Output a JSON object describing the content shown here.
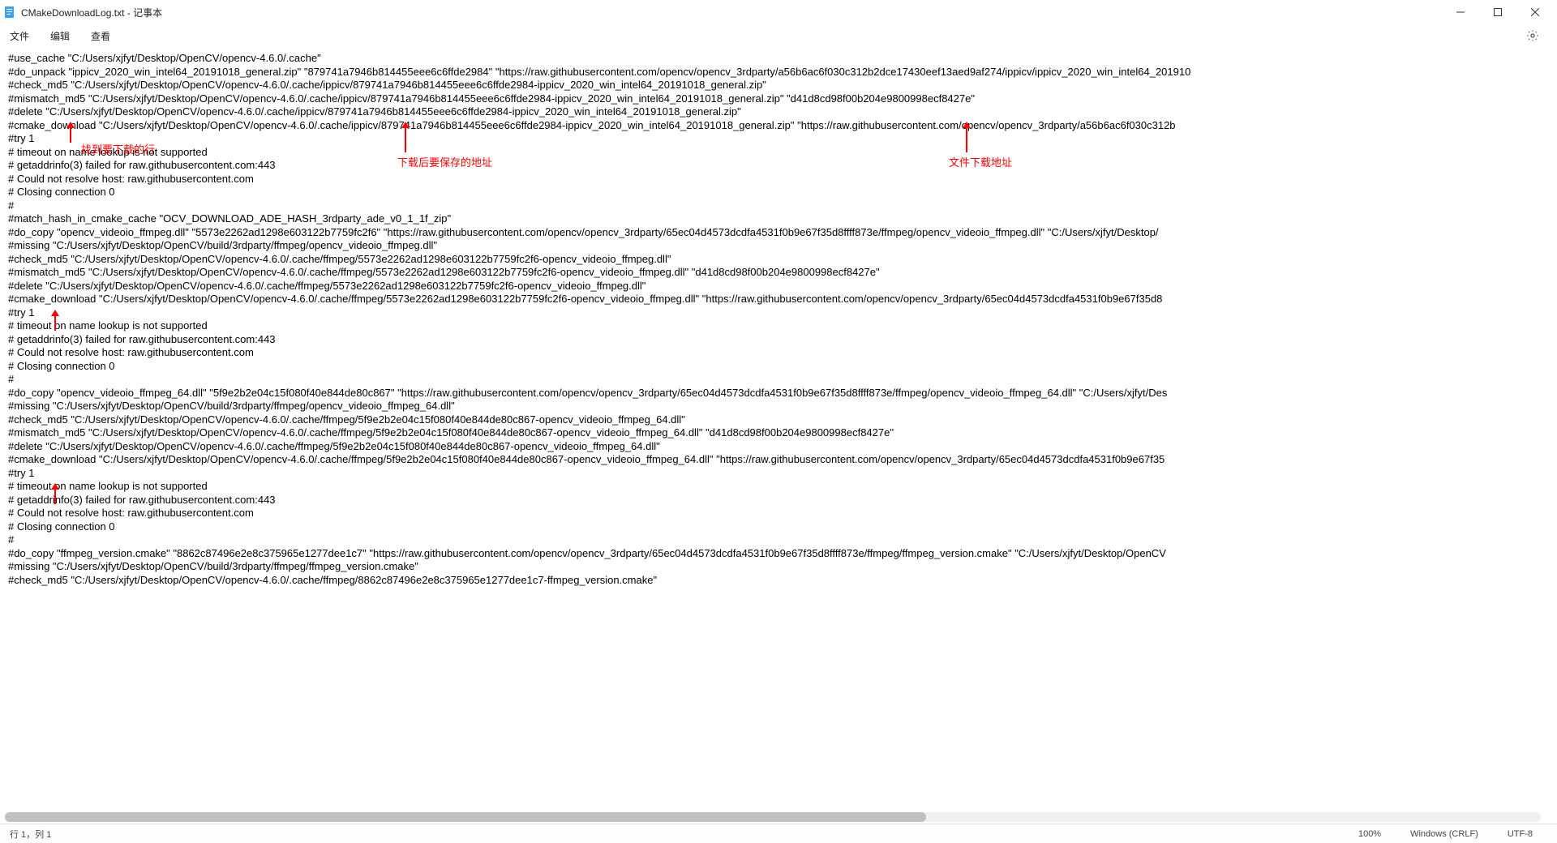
{
  "window": {
    "title": "CMakeDownloadLog.txt - 记事本"
  },
  "menu": {
    "file": "文件",
    "edit": "编辑",
    "view": "查看"
  },
  "annotations": {
    "a1": "找到要下载的行",
    "a2": "下载后要保存的地址",
    "a3": "文件下载地址"
  },
  "lines": {
    "l0": "#use_cache \"C:/Users/xjfyt/Desktop/OpenCV/opencv-4.6.0/.cache\"",
    "l1": "#do_unpack \"ippicv_2020_win_intel64_20191018_general.zip\" \"879741a7946b814455eee6c6ffde2984\" \"https://raw.githubusercontent.com/opencv/opencv_3rdparty/a56b6ac6f030c312b2dce17430eef13aed9af274/ippicv/ippicv_2020_win_intel64_201910",
    "l2": "#check_md5 \"C:/Users/xjfyt/Desktop/OpenCV/opencv-4.6.0/.cache/ippicv/879741a7946b814455eee6c6ffde2984-ippicv_2020_win_intel64_20191018_general.zip\"",
    "l3": "#mismatch_md5 \"C:/Users/xjfyt/Desktop/OpenCV/opencv-4.6.0/.cache/ippicv/879741a7946b814455eee6c6ffde2984-ippicv_2020_win_intel64_20191018_general.zip\" \"d41d8cd98f00b204e9800998ecf8427e\"",
    "l4": "#delete \"C:/Users/xjfyt/Desktop/OpenCV/opencv-4.6.0/.cache/ippicv/879741a7946b814455eee6c6ffde2984-ippicv_2020_win_intel64_20191018_general.zip\"",
    "l5": "#cmake_download \"C:/Users/xjfyt/Desktop/OpenCV/opencv-4.6.0/.cache/ippicv/879741a7946b814455eee6c6ffde2984-ippicv_2020_win_intel64_20191018_general.zip\" \"https://raw.githubusercontent.com/opencv/opencv_3rdparty/a56b6ac6f030c312b",
    "l6": "#try 1",
    "l7": "# timeout on name lookup is not supported",
    "l8": "# getaddrinfo(3) failed for raw.githubusercontent.com:443",
    "l9": "# Could not resolve host: raw.githubusercontent.com",
    "l10": "# Closing connection 0",
    "l11": "#",
    "l12": "",
    "l13": "#match_hash_in_cmake_cache \"OCV_DOWNLOAD_ADE_HASH_3rdparty_ade_v0_1_1f_zip\"",
    "l14": "#do_copy \"opencv_videoio_ffmpeg.dll\" \"5573e2262ad1298e603122b7759fc2f6\" \"https://raw.githubusercontent.com/opencv/opencv_3rdparty/65ec04d4573dcdfa4531f0b9e67f35d8ffff873e/ffmpeg/opencv_videoio_ffmpeg.dll\" \"C:/Users/xjfyt/Desktop/",
    "l15": "#missing \"C:/Users/xjfyt/Desktop/OpenCV/build/3rdparty/ffmpeg/opencv_videoio_ffmpeg.dll\"",
    "l16": "#check_md5 \"C:/Users/xjfyt/Desktop/OpenCV/opencv-4.6.0/.cache/ffmpeg/5573e2262ad1298e603122b7759fc2f6-opencv_videoio_ffmpeg.dll\"",
    "l17": "#mismatch_md5 \"C:/Users/xjfyt/Desktop/OpenCV/opencv-4.6.0/.cache/ffmpeg/5573e2262ad1298e603122b7759fc2f6-opencv_videoio_ffmpeg.dll\" \"d41d8cd98f00b204e9800998ecf8427e\"",
    "l18": "#delete \"C:/Users/xjfyt/Desktop/OpenCV/opencv-4.6.0/.cache/ffmpeg/5573e2262ad1298e603122b7759fc2f6-opencv_videoio_ffmpeg.dll\"",
    "l19": "#cmake_download \"C:/Users/xjfyt/Desktop/OpenCV/opencv-4.6.0/.cache/ffmpeg/5573e2262ad1298e603122b7759fc2f6-opencv_videoio_ffmpeg.dll\" \"https://raw.githubusercontent.com/opencv/opencv_3rdparty/65ec04d4573dcdfa4531f0b9e67f35d8",
    "l20": "#try 1",
    "l21": "# timeout on name lookup is not supported",
    "l22": "# getaddrinfo(3) failed for raw.githubusercontent.com:443",
    "l23": "# Could not resolve host: raw.githubusercontent.com",
    "l24": "# Closing connection 0",
    "l25": "#",
    "l26": "",
    "l27": "#do_copy \"opencv_videoio_ffmpeg_64.dll\" \"5f9e2b2e04c15f080f40e844de80c867\" \"https://raw.githubusercontent.com/opencv/opencv_3rdparty/65ec04d4573dcdfa4531f0b9e67f35d8ffff873e/ffmpeg/opencv_videoio_ffmpeg_64.dll\" \"C:/Users/xjfyt/Des",
    "l28": "#missing \"C:/Users/xjfyt/Desktop/OpenCV/build/3rdparty/ffmpeg/opencv_videoio_ffmpeg_64.dll\"",
    "l29": "#check_md5 \"C:/Users/xjfyt/Desktop/OpenCV/opencv-4.6.0/.cache/ffmpeg/5f9e2b2e04c15f080f40e844de80c867-opencv_videoio_ffmpeg_64.dll\"",
    "l30": "#mismatch_md5 \"C:/Users/xjfyt/Desktop/OpenCV/opencv-4.6.0/.cache/ffmpeg/5f9e2b2e04c15f080f40e844de80c867-opencv_videoio_ffmpeg_64.dll\" \"d41d8cd98f00b204e9800998ecf8427e\"",
    "l31": "#delete \"C:/Users/xjfyt/Desktop/OpenCV/opencv-4.6.0/.cache/ffmpeg/5f9e2b2e04c15f080f40e844de80c867-opencv_videoio_ffmpeg_64.dll\"",
    "l32": "#cmake_download \"C:/Users/xjfyt/Desktop/OpenCV/opencv-4.6.0/.cache/ffmpeg/5f9e2b2e04c15f080f40e844de80c867-opencv_videoio_ffmpeg_64.dll\" \"https://raw.githubusercontent.com/opencv/opencv_3rdparty/65ec04d4573dcdfa4531f0b9e67f35",
    "l33": "#try 1",
    "l34": "# timeout on name lookup is not supported",
    "l35": "# getaddrinfo(3) failed for raw.githubusercontent.com:443",
    "l36": "# Could not resolve host: raw.githubusercontent.com",
    "l37": "# Closing connection 0",
    "l38": "#",
    "l39": "",
    "l40": "#do_copy \"ffmpeg_version.cmake\" \"8862c87496e2e8c375965e1277dee1c7\" \"https://raw.githubusercontent.com/opencv/opencv_3rdparty/65ec04d4573dcdfa4531f0b9e67f35d8ffff873e/ffmpeg/ffmpeg_version.cmake\" \"C:/Users/xjfyt/Desktop/OpenCV",
    "l41": "#missing \"C:/Users/xjfyt/Desktop/OpenCV/build/3rdparty/ffmpeg/ffmpeg_version.cmake\"",
    "l42": "#check_md5 \"C:/Users/xjfyt/Desktop/OpenCV/opencv-4.6.0/.cache/ffmpeg/8862c87496e2e8c375965e1277dee1c7-ffmpeg_version.cmake\""
  },
  "status": {
    "pos": "行 1，列 1",
    "zoom": "100%",
    "eol": "Windows (CRLF)",
    "enc": "UTF-8"
  }
}
